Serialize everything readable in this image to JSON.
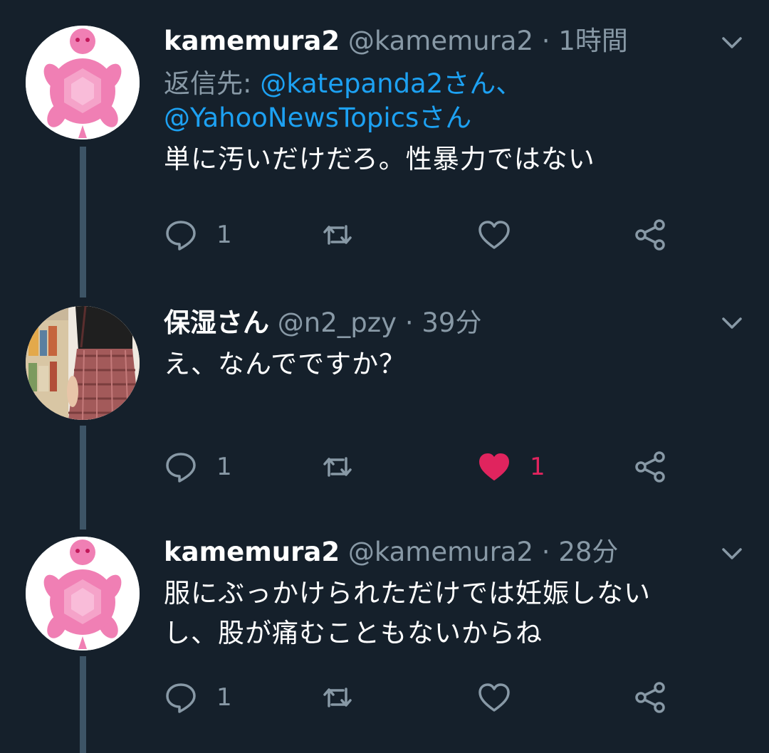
{
  "tweets": [
    {
      "display_name": "kamemura2",
      "handle": "@kamemura2",
      "separator": "·",
      "time": "1時間",
      "reply_prefix": "返信先:",
      "reply_mention_1": "@katepanda2さん、",
      "reply_mention_2": "@YahooNewsTopicsさん",
      "text": "単に汚いだけだろ。性暴力ではない",
      "reply_count": "1",
      "retweet_count": "",
      "like_count": "",
      "liked": false,
      "avatar_icon": "pink-turtle-icon"
    },
    {
      "display_name": "保湿さん",
      "handle": "@n2_pzy",
      "separator": "·",
      "time": "39分",
      "text": "え、なんでですか？",
      "reply_count": "1",
      "retweet_count": "",
      "like_count": "1",
      "liked": true,
      "avatar_icon": "photo-avatar"
    },
    {
      "display_name": "kamemura2",
      "handle": "@kamemura2",
      "separator": "·",
      "time": "28分",
      "text_line_1": "服にぶっかけられただけでは妊娠しない",
      "text_line_2": "し、股が痛むこともないからね",
      "reply_count": "1",
      "retweet_count": "",
      "like_count": "",
      "liked": false,
      "avatar_icon": "pink-turtle-icon"
    }
  ],
  "colors": {
    "background": "#15202b",
    "text": "#ffffff",
    "secondary": "#8899a6",
    "link": "#1da1f2",
    "like_active": "#e0245e",
    "thread_line": "#3d5466"
  }
}
